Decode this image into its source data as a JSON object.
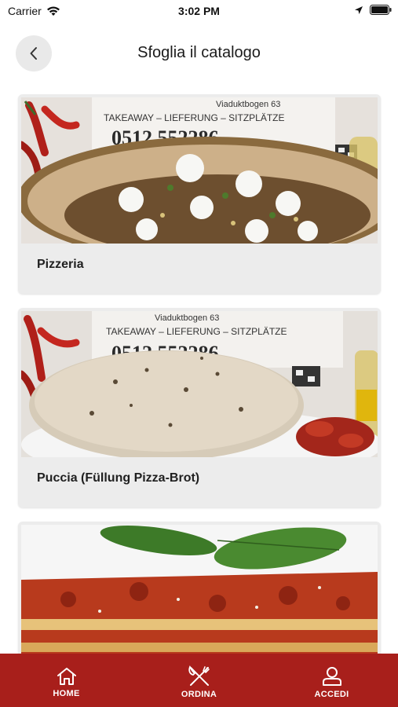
{
  "status_bar": {
    "carrier": "Carrier",
    "time": "3:02 PM"
  },
  "header": {
    "title": "Sfoglia il catalogo"
  },
  "catalog": {
    "items": [
      {
        "label": "Pizzeria",
        "image": "pizza-photo",
        "sign_address": "Viaduktbogen 63",
        "sign_services": "TAKEAWAY – LIEFERUNG – SITZPLÄTZE",
        "sign_phone": "0512 552286"
      },
      {
        "label": "Puccia (Füllung Pizza-Brot)",
        "image": "puccia-photo",
        "sign_address": "Viaduktbogen 63",
        "sign_services": "TAKEAWAY – LIEFERUNG – SITZPLÄTZE",
        "sign_phone": "0512 552286"
      },
      {
        "label": "",
        "image": "lasagna-photo"
      }
    ]
  },
  "tabbar": {
    "home_label": "HOME",
    "order_label": "ORDINA",
    "login_label": "ACCEDI"
  },
  "colors": {
    "brand": "#a81f1b",
    "card_bg": "#ececec",
    "back_bg": "#e9e9e9"
  }
}
